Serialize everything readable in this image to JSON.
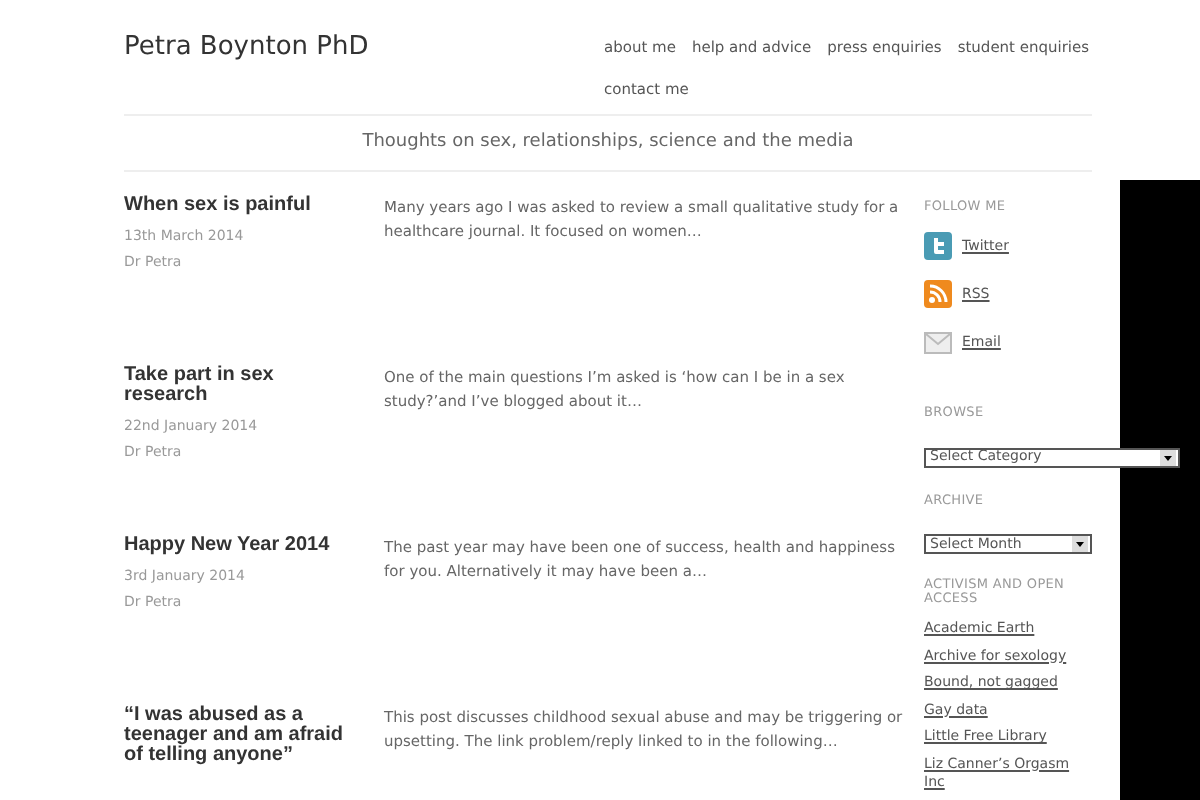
{
  "site_title": "Petra Boynton PhD",
  "nav": [
    {
      "label": "about me"
    },
    {
      "label": "help and advice"
    },
    {
      "label": "press enquiries"
    },
    {
      "label": "student enquiries"
    },
    {
      "label": "contact me"
    }
  ],
  "tagline": "Thoughts on sex, relationships, science and the media",
  "posts": [
    {
      "title": "When sex is painful",
      "date": "13th March 2014",
      "author": "Dr Petra",
      "excerpt": "Many years ago I was asked to review a small qualitative study for a healthcare journal. It focused on women…"
    },
    {
      "title": "Take part in sex research",
      "date": "22nd January 2014",
      "author": "Dr Petra",
      "excerpt": "One of the main questions I’m asked is ‘how can I be in a sex study?’and I’ve blogged about it…"
    },
    {
      "title": "Happy New Year 2014",
      "date": "3rd January 2014",
      "author": "Dr Petra",
      "excerpt": "The past year may have been one of success, health and happiness for you. Alternatively it may have been a…"
    },
    {
      "title": "“I was abused as a teenager and am afraid of telling anyone”",
      "excerpt": "This post discusses childhood sexual abuse and may be triggering or upsetting. The link problem/reply linked to in the following…"
    }
  ],
  "sidebar": {
    "follow": {
      "heading": "FOLLOW ME",
      "links": [
        {
          "kind": "twitter",
          "label": "Twitter"
        },
        {
          "kind": "rss",
          "label": "RSS"
        },
        {
          "kind": "email",
          "label": "Email"
        }
      ]
    },
    "browse": {
      "heading": "BROWSE",
      "select": "Select Category"
    },
    "archive": {
      "heading": "ARCHIVE",
      "select": "Select Month"
    },
    "activism": {
      "heading": "ACTIVISM AND OPEN ACCESS",
      "links": [
        "Academic Earth",
        "Archive for sexology",
        "Bound, not gagged",
        "Gay data",
        "Little Free Library",
        "Liz Canner’s Orgasm Inc"
      ]
    }
  }
}
